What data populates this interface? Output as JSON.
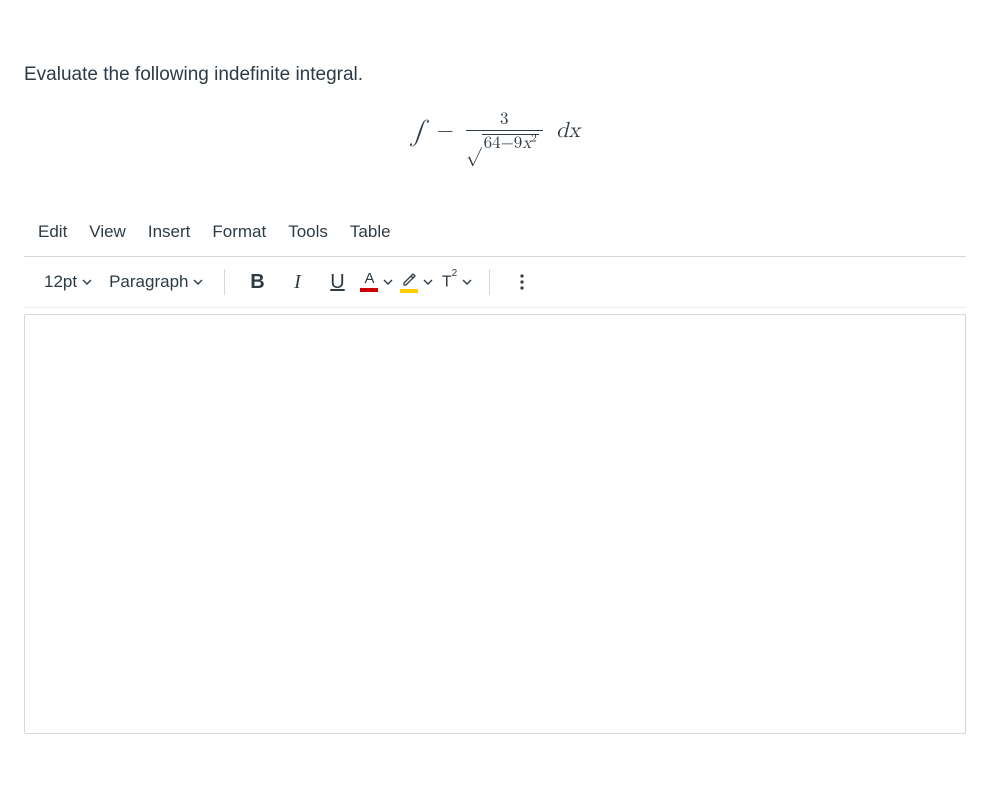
{
  "prompt": "Evaluate the following indefinite integral.",
  "math": {
    "integral_sign": "∫",
    "minus": "−",
    "numerator": "3",
    "surd": "√",
    "radicand_a": "64−9",
    "radicand_var": "x",
    "radicand_exp": "2",
    "dx_d": "d",
    "dx_x": "x"
  },
  "menu": {
    "edit": "Edit",
    "view": "View",
    "insert": "Insert",
    "format": "Format",
    "tools": "Tools",
    "table": "Table"
  },
  "toolbar": {
    "font_size": "12pt",
    "block_format": "Paragraph",
    "bold": "B",
    "italic": "I",
    "underline": "U",
    "text_color_letter": "A",
    "superscript_T": "T",
    "superscript_exp": "2"
  }
}
